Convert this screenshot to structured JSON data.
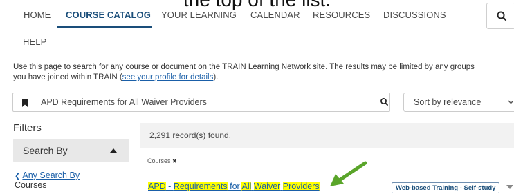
{
  "caption": "the top of the list.",
  "colors": {
    "accent": "#1a4e7a",
    "link": "#1a5fa8",
    "highlight": "#ffff00",
    "arrow": "#5aa52a"
  },
  "nav": {
    "items": [
      {
        "label": "HOME",
        "active": false
      },
      {
        "label": "COURSE CATALOG",
        "active": true
      },
      {
        "label": "YOUR LEARNING",
        "active": false
      },
      {
        "label": "CALENDAR",
        "active": false
      },
      {
        "label": "RESOURCES",
        "active": false
      },
      {
        "label": "DISCUSSIONS",
        "active": false
      },
      {
        "label": "HELP",
        "active": false
      }
    ],
    "search_icon": "search-icon"
  },
  "intro": {
    "line1": "Use this page to search for any course or document on the TRAIN Learning Network site. The results may be limited by any groups",
    "line2_prefix": "you have joined within TRAIN (",
    "link": "see your profile for details",
    "line2_suffix": ")."
  },
  "search": {
    "icon": "bookmark-icon",
    "value": "APD Requirements for All Waiver Providers",
    "button_icon": "search-icon"
  },
  "sort": {
    "label": "Sort by relevance",
    "icon": "chevron-down-icon"
  },
  "filters": {
    "heading": "Filters",
    "search_by": "Search By",
    "any_search_chevron": "❮",
    "any_search": "Any Search By",
    "sub": "Courses"
  },
  "results": {
    "count": "2,291 record(s) found.",
    "tag": "Courses",
    "tag_close": "✖",
    "title_parts": [
      {
        "text": "APD",
        "hl": true
      },
      {
        "text": " - ",
        "hl": false
      },
      {
        "text": "Requirements",
        "hl": true
      },
      {
        "text": " for ",
        "hl": false
      },
      {
        "text": "All",
        "hl": true
      },
      {
        "text": " ",
        "hl": false
      },
      {
        "text": "Waiver",
        "hl": true
      },
      {
        "text": " ",
        "hl": false
      },
      {
        "text": "Providers",
        "hl": true
      }
    ],
    "type_badge": "Web-based Training - Self-study"
  }
}
